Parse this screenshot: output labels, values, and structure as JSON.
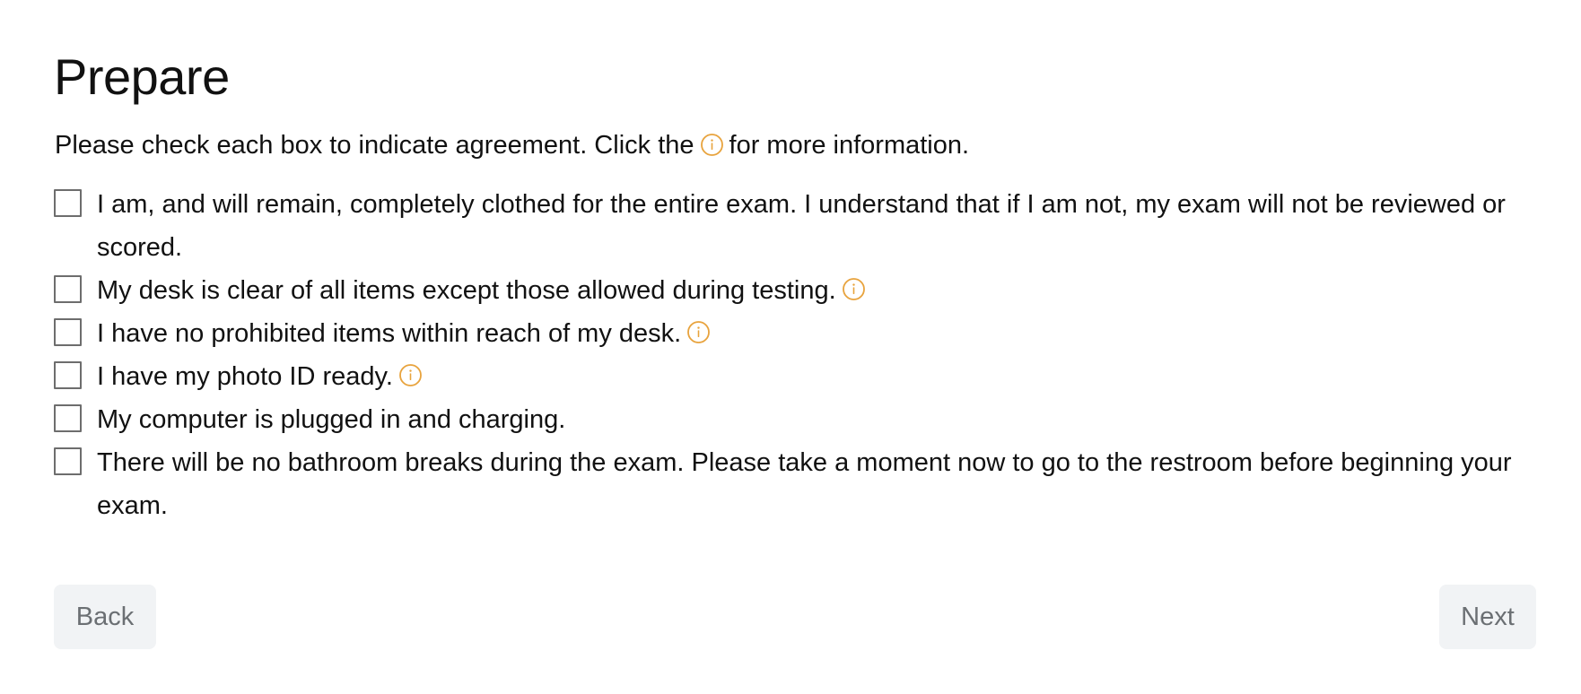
{
  "page": {
    "title": "Prepare",
    "instructions_before": "Please check each box to indicate agreement. Click the",
    "instructions_after": "for more information."
  },
  "checklist": {
    "items": [
      {
        "label": "I am, and will remain, completely clothed for the entire exam. I understand that if I am not, my exam will not be reviewed or scored.",
        "checked": false,
        "has_info": false
      },
      {
        "label": "My desk is clear of all items except those allowed during testing.",
        "checked": false,
        "has_info": true
      },
      {
        "label": "I have no prohibited items within reach of my desk.",
        "checked": false,
        "has_info": true
      },
      {
        "label": "I have my photo ID ready.",
        "checked": false,
        "has_info": true
      },
      {
        "label": "My computer is plugged in and charging.",
        "checked": false,
        "has_info": false
      },
      {
        "label": "There will be no bathroom breaks during the exam. Please take a moment now to go to the restroom before beginning your exam.",
        "checked": false,
        "has_info": false
      }
    ]
  },
  "navigation": {
    "back_label": "Back",
    "next_label": "Next"
  },
  "icons": {
    "info": "info-circle-icon"
  },
  "colors": {
    "info_icon": "#e8a33d",
    "button_bg": "#f1f3f5",
    "button_text": "#6b6f73"
  }
}
